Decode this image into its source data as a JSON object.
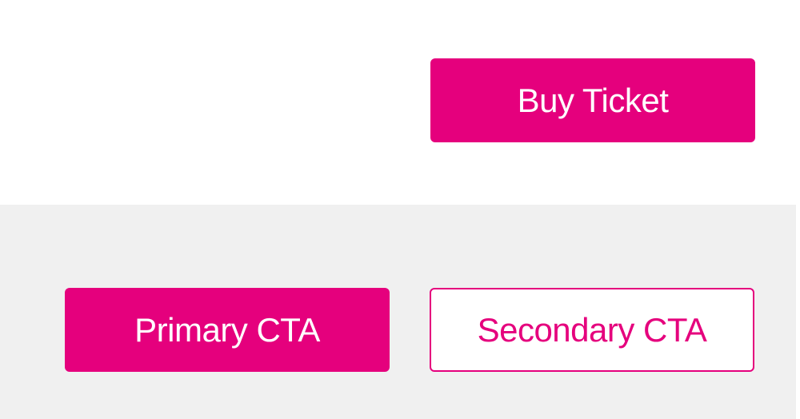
{
  "colors": {
    "brand": "#e5007d",
    "band": "#f0f0f0"
  },
  "top": {
    "buy_ticket_label": "Buy Ticket"
  },
  "showcase": {
    "primary_label": "Primary CTA",
    "secondary_label": "Secondary CTA"
  }
}
